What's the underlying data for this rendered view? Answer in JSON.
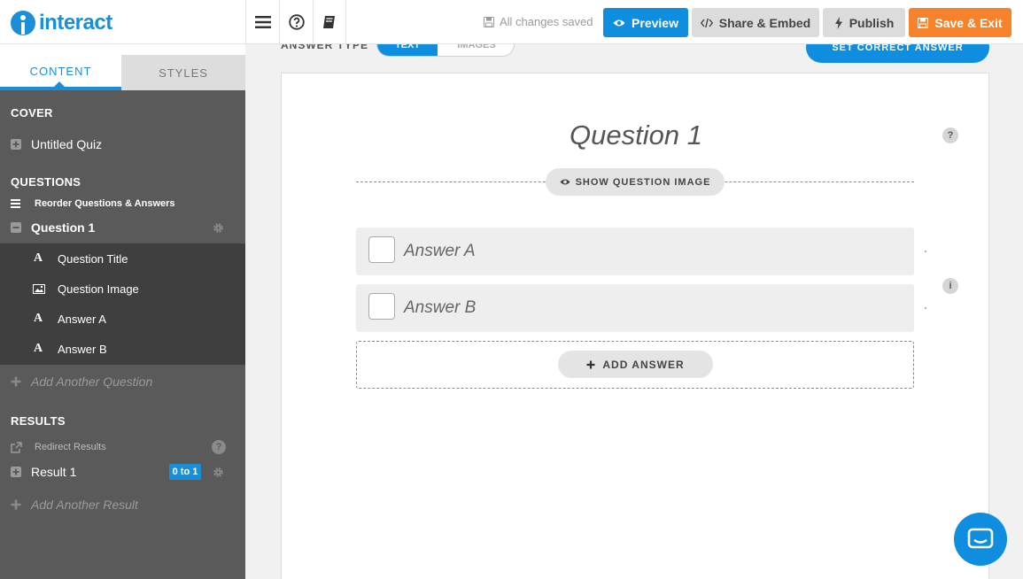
{
  "app": {
    "name": "interact"
  },
  "toolbar": {
    "saved_status": "All changes saved",
    "preview_label": "Preview",
    "share_label": "Share & Embed",
    "publish_label": "Publish",
    "save_exit_label": "Save & Exit",
    "icons": [
      "menu-icon",
      "help-icon",
      "book-icon"
    ]
  },
  "sidebar": {
    "tabs": [
      {
        "label": "CONTENT",
        "active": true
      },
      {
        "label": "STYLES",
        "active": false
      }
    ],
    "cover": {
      "heading": "COVER",
      "item": "Untitled Quiz"
    },
    "questions": {
      "heading": "QUESTIONS",
      "reorder": "Reorder Questions & Answers",
      "current": "Question 1",
      "subitems": [
        {
          "icon": "text-icon",
          "label": "Question Title"
        },
        {
          "icon": "image-icon",
          "label": "Question Image"
        },
        {
          "icon": "text-icon",
          "label": "Answer A"
        },
        {
          "icon": "text-icon",
          "label": "Answer B"
        }
      ],
      "add": "Add Another Question"
    },
    "results": {
      "heading": "RESULTS",
      "redirect": "Redirect Results",
      "result": "Result 1",
      "result_badge": "0 to 1",
      "add": "Add Another Result"
    }
  },
  "editor": {
    "answer_type_label": "ANSWER TYPE",
    "answer_type_options": [
      "TEXT",
      "IMAGES"
    ],
    "answer_type_selected": "TEXT",
    "set_correct_label": "SET CORRECT ANSWER",
    "question_title": "Question 1",
    "show_image_label": "SHOW QUESTION IMAGE",
    "answers": [
      "Answer A",
      "Answer B"
    ],
    "add_answer_label": "ADD ANSWER"
  },
  "colors": {
    "brand": "#1a8fd8",
    "primary_button": "#0f8ddf",
    "save_button": "#f6832c",
    "sidebar_bg": "#5a5a5a"
  }
}
